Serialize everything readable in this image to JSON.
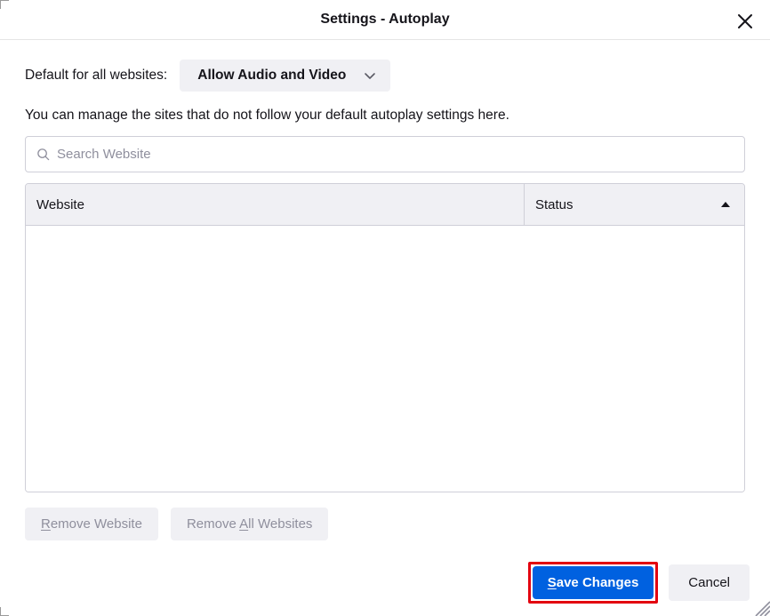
{
  "title": "Settings - Autoplay",
  "default_label": "Default for all websites:",
  "dropdown_value": "Allow Audio and Video",
  "description": "You can manage the sites that do not follow your default autoplay settings here.",
  "search_placeholder": "Search Website",
  "columns": {
    "website": "Website",
    "status": "Status"
  },
  "buttons": {
    "remove": {
      "u": "R",
      "rest": "emove Website"
    },
    "remove_all": {
      "pre": "Remove ",
      "u": "A",
      "rest": "ll Websites"
    },
    "save": {
      "u": "S",
      "rest": "ave Changes"
    },
    "cancel": "Cancel"
  }
}
